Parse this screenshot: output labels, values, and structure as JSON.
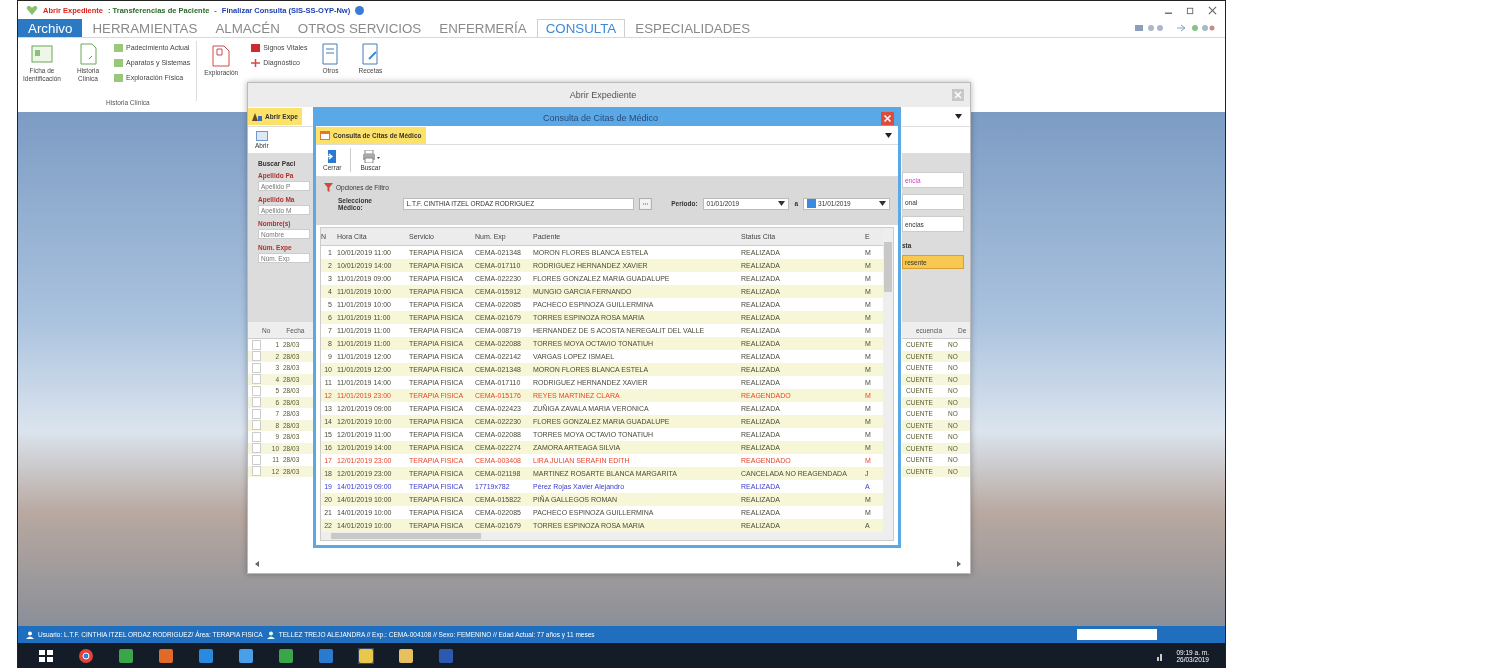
{
  "window": {
    "title_segments": [
      {
        "text": "Abrir Expediente",
        "kind": "form"
      },
      {
        "text": ": Transferencias de Paciente",
        "kind": "module"
      },
      {
        "text": "-",
        "kind": "separator"
      },
      {
        "text": "Finalizar Consulta (SIS-SS-OYP-Nw)",
        "kind": "action"
      }
    ]
  },
  "menu_tabs": [
    {
      "label": "Archivo",
      "kind": "file",
      "selected": false
    },
    {
      "label": "HERRAMIENTAS",
      "kind": "tab",
      "selected": false
    },
    {
      "label": "ALMACÉN",
      "kind": "tab",
      "selected": false
    },
    {
      "label": "OTROS SERVICIOS",
      "kind": "tab",
      "selected": false
    },
    {
      "label": "ENFERMERÍA",
      "kind": "tab",
      "selected": false
    },
    {
      "label": "CONSULTA",
      "kind": "tab",
      "selected": true
    },
    {
      "label": "ESPECIALIDADES",
      "kind": "tab",
      "selected": false
    }
  ],
  "ribbon": {
    "large_buttons": [
      {
        "label": "Ficha de Identificación",
        "kind": "id"
      },
      {
        "label": "Historia Clínica",
        "kind": "doc"
      }
    ],
    "small_buttons": [
      "Padecimiento Actual",
      "Aparatos y Sistemas",
      "Exploración Física"
    ],
    "group_label": "Historia Clínica",
    "cut_button": "Exploración",
    "small_buttons_2": [
      "Signos Vitales",
      "Diagnóstico"
    ],
    "large_buttons_2": [
      {
        "label": "Otros",
        "kind": "doc"
      },
      {
        "label": "Recetas",
        "kind": "pen"
      }
    ]
  },
  "back_dialog": {
    "title": "Abrir Expediente",
    "tab": "Abrir Expe",
    "toolbar": [
      "Abrir"
    ],
    "search_title": "Buscar Paci",
    "fields": [
      {
        "label": "Apellido Pa",
        "placeholder": "Apellido P"
      },
      {
        "label": "Apellido Ma",
        "placeholder": "Apellido M"
      },
      {
        "label": "Nombre(s)",
        "placeholder": "Nombre"
      },
      {
        "label": "Núm. Expe",
        "placeholder": "Núm. Exp"
      }
    ],
    "right_buttons": [
      "encia",
      "onal",
      "encias"
    ],
    "right_label": "sta",
    "highlight_button": "resente",
    "columns_left": [
      "No",
      "Fecha"
    ],
    "columns_right": [
      "ecuencia",
      "De"
    ],
    "rows": [
      {
        "no": "1",
        "fecha": "28/03",
        "tipo": "CUENTE",
        "de": "NO",
        "checked": false
      },
      {
        "no": "2",
        "fecha": "28/03",
        "tipo": "CUENTE",
        "de": "NO",
        "checked": false
      },
      {
        "no": "3",
        "fecha": "28/03",
        "tipo": "CUENTE",
        "de": "NO",
        "checked": false
      },
      {
        "no": "4",
        "fecha": "28/03",
        "tipo": "CUENTE",
        "de": "NO",
        "checked": false
      },
      {
        "no": "5",
        "fecha": "28/03",
        "tipo": "CUENTE",
        "de": "NO",
        "checked": false
      },
      {
        "no": "6",
        "fecha": "28/03",
        "tipo": "CUENTE",
        "de": "NO",
        "checked": false
      },
      {
        "no": "7",
        "fecha": "28/03",
        "tipo": "CUENTE",
        "de": "NO",
        "checked": false
      },
      {
        "no": "8",
        "fecha": "28/03",
        "tipo": "CUENTE",
        "de": "NO",
        "checked": false
      },
      {
        "no": "9",
        "fecha": "28/03",
        "tipo": "CUENTE",
        "de": "NO",
        "checked": false
      },
      {
        "no": "10",
        "fecha": "28/03",
        "tipo": "CUENTE",
        "de": "NO",
        "checked": false
      },
      {
        "no": "11",
        "fecha": "28/03",
        "tipo": "CUENTE",
        "de": "NO",
        "checked": false
      },
      {
        "no": "12",
        "fecha": "28/03",
        "tipo": "CUENTE",
        "de": "NO",
        "checked": false
      }
    ]
  },
  "front_dialog": {
    "title": "Consulta de Citas de Médico",
    "tab": "Consulta de Citas de Médico",
    "toolbar": [
      {
        "label": "Cerrar",
        "kind": "close"
      },
      {
        "label": "Buscar",
        "kind": "print"
      }
    ],
    "filter_title": "Opciones de Filtro",
    "doctor_label": "Seleccione Médico:",
    "doctor_value": "L.T.F. CINTHIA ITZEL ORDAZ RODRIGUEZ",
    "period_label": "Periodo:",
    "date_from": "01/01/2019",
    "to_label": "a",
    "date_to": "31/01/2019",
    "columns": [
      "N",
      "Hora Cita",
      "Servicio",
      "Num. Exp",
      "Paciente",
      "Status Cita",
      "E"
    ],
    "rows": [
      {
        "n": "1",
        "hora": "10/01/2019 11:00",
        "servicio": "TERAPIA FISICA",
        "exp": "CEMA-021348",
        "paciente": "MORON FLORES BLANCA ESTELA",
        "status": "REALIZADA",
        "col_7": "M",
        "kind": "normal"
      },
      {
        "n": "2",
        "hora": "10/01/2019 14:00",
        "servicio": "TERAPIA FISICA",
        "exp": "CEMA-017110",
        "paciente": "RODRIGUEZ HERNANDEZ XAVIER",
        "status": "REALIZADA",
        "col_7": "M",
        "kind": "normal"
      },
      {
        "n": "3",
        "hora": "11/01/2019 09:00",
        "servicio": "TERAPIA FISICA",
        "exp": "CEMA-022230",
        "paciente": "FLORES GONZALEZ MARIA GUADALUPE",
        "status": "REALIZADA",
        "col_7": "M",
        "kind": "normal"
      },
      {
        "n": "4",
        "hora": "11/01/2019 10:00",
        "servicio": "TERAPIA FISICA",
        "exp": "CEMA-015912",
        "paciente": "MUNGIO GARCIA FERNANDO",
        "status": "REALIZADA",
        "col_7": "M",
        "kind": "normal"
      },
      {
        "n": "5",
        "hora": "11/01/2019 10:00",
        "servicio": "TERAPIA FISICA",
        "exp": "CEMA-022085",
        "paciente": "PACHECO ESPINOZA GUILLERMINA",
        "status": "REALIZADA",
        "col_7": "M",
        "kind": "normal"
      },
      {
        "n": "6",
        "hora": "11/01/2019 11:00",
        "servicio": "TERAPIA FISICA",
        "exp": "CEMA-021679",
        "paciente": "TORRES ESPINOZA ROSA MARIA",
        "status": "REALIZADA",
        "col_7": "M",
        "kind": "normal"
      },
      {
        "n": "7",
        "hora": "11/01/2019 11:00",
        "servicio": "TERAPIA FISICA",
        "exp": "CEMA-008719",
        "paciente": "HERNANDEZ DE S ACOSTA NEREGALIT DEL VALLE",
        "status": "REALIZADA",
        "col_7": "M",
        "kind": "normal"
      },
      {
        "n": "8",
        "hora": "11/01/2019 11:00",
        "servicio": "TERAPIA FISICA",
        "exp": "CEMA-022088",
        "paciente": "TORRES MOYA OCTAVIO TONATIUH",
        "status": "REALIZADA",
        "col_7": "M",
        "kind": "normal"
      },
      {
        "n": "9",
        "hora": "11/01/2019 12:00",
        "servicio": "TERAPIA FISICA",
        "exp": "CEMA-022142",
        "paciente": "VARGAS LOPEZ ISMAEL",
        "status": "REALIZADA",
        "col_7": "M",
        "kind": "normal"
      },
      {
        "n": "10",
        "hora": "11/01/2019 12:00",
        "servicio": "TERAPIA FISICA",
        "exp": "CEMA-021348",
        "paciente": "MORON FLORES BLANCA ESTELA",
        "status": "REALIZADA",
        "col_7": "M",
        "kind": "normal"
      },
      {
        "n": "11",
        "hora": "11/01/2019 14:00",
        "servicio": "TERAPIA FISICA",
        "exp": "CEMA-017110",
        "paciente": "RODRIGUEZ HERNANDEZ XAVIER",
        "status": "REALIZADA",
        "col_7": "M",
        "kind": "normal"
      },
      {
        "n": "12",
        "hora": "11/01/2019 23:00",
        "servicio": "TERAPIA FISICA",
        "exp": "CEMA-015176",
        "paciente": "REYES MARTINEZ CLARA",
        "status": "REAGENDADO",
        "col_7": "M",
        "kind": "rescheduled"
      },
      {
        "n": "13",
        "hora": "12/01/2019 09:00",
        "servicio": "TERAPIA FISICA",
        "exp": "CEMA-022423",
        "paciente": "ZUÑIGA ZAVALA MARIA VERONICA",
        "status": "REALIZADA",
        "col_7": "M",
        "kind": "normal"
      },
      {
        "n": "14",
        "hora": "12/01/2019 10:00",
        "servicio": "TERAPIA FISICA",
        "exp": "CEMA-022230",
        "paciente": "FLORES GONZALEZ MARIA GUADALUPE",
        "status": "REALIZADA",
        "col_7": "M",
        "kind": "normal"
      },
      {
        "n": "15",
        "hora": "12/01/2019 11:00",
        "servicio": "TERAPIA FISICA",
        "exp": "CEMA-022088",
        "paciente": "TORRES MOYA OCTAVIO TONATIUH",
        "status": "REALIZADA",
        "col_7": "M",
        "kind": "normal"
      },
      {
        "n": "16",
        "hora": "12/01/2019 14:00",
        "servicio": "TERAPIA FISICA",
        "exp": "CEMA-022274",
        "paciente": "ZAMORA ARTEAGA SILVIA",
        "status": "REALIZADA",
        "col_7": "M",
        "kind": "normal"
      },
      {
        "n": "17",
        "hora": "12/01/2019 23:00",
        "servicio": "TERAPIA FISICA",
        "exp": "CEMA-003408",
        "paciente": "LIRA JULIAN SERAFIN EDITH",
        "status": "REAGENDADO",
        "col_7": "M",
        "kind": "rescheduled"
      },
      {
        "n": "18",
        "hora": "12/01/2019 23:00",
        "servicio": "TERAPIA FISICA",
        "exp": "CEMA-021198",
        "paciente": "MARTINEZ ROSARTE BLANCA MARGARITA",
        "status": "CANCELADA NO REAGENDADA",
        "col_7": "J",
        "kind": "normal"
      },
      {
        "n": "19",
        "hora": "14/01/2019 09:00",
        "servicio": "TERAPIA FISICA",
        "exp": "17719x782",
        "paciente": "Pérez Rojas Xavier Alejandro",
        "status": "REALIZADA",
        "col_7": "A",
        "kind": "external"
      },
      {
        "n": "20",
        "hora": "14/01/2019 10:00",
        "servicio": "TERAPIA FISICA",
        "exp": "CEMA-015822",
        "paciente": "PIÑA GALLEGOS ROMAN",
        "status": "REALIZADA",
        "col_7": "M",
        "kind": "normal"
      },
      {
        "n": "21",
        "hora": "14/01/2019 10:00",
        "servicio": "TERAPIA FISICA",
        "exp": "CEMA-022085",
        "paciente": "PACHECO ESPINOZA GUILLERMINA",
        "status": "REALIZADA",
        "col_7": "M",
        "kind": "normal"
      },
      {
        "n": "22",
        "hora": "14/01/2019 10:00",
        "servicio": "TERAPIA FISICA",
        "exp": "CEMA-021679",
        "paciente": "TORRES ESPINOZA ROSA MARIA",
        "status": "REALIZADA",
        "col_7": "A",
        "kind": "normal"
      }
    ]
  },
  "status_bar": {
    "user": "Usuario: L.T.F. CINTHIA ITZEL ORDAZ RODRIGUEZ/ Área: TERAPIA FISICA",
    "patient": "TELLEZ TREJO ALEJANDRA // Exp.: CEMA-004108 // Sexo: FEMENINO // Edad Actual: 77 años y 11 meses"
  },
  "taskbar": {
    "apps": [
      {
        "kind": "start"
      },
      {
        "kind": "chrome"
      },
      {
        "kind": "green"
      },
      {
        "kind": "orange"
      },
      {
        "kind": "ie"
      },
      {
        "kind": "mail"
      },
      {
        "kind": "green"
      },
      {
        "kind": "blue"
      },
      {
        "kind": "yellow"
      },
      {
        "kind": "folder"
      },
      {
        "kind": "word"
      }
    ],
    "time": "09:19 a. m.",
    "date": "26/03/2019"
  }
}
